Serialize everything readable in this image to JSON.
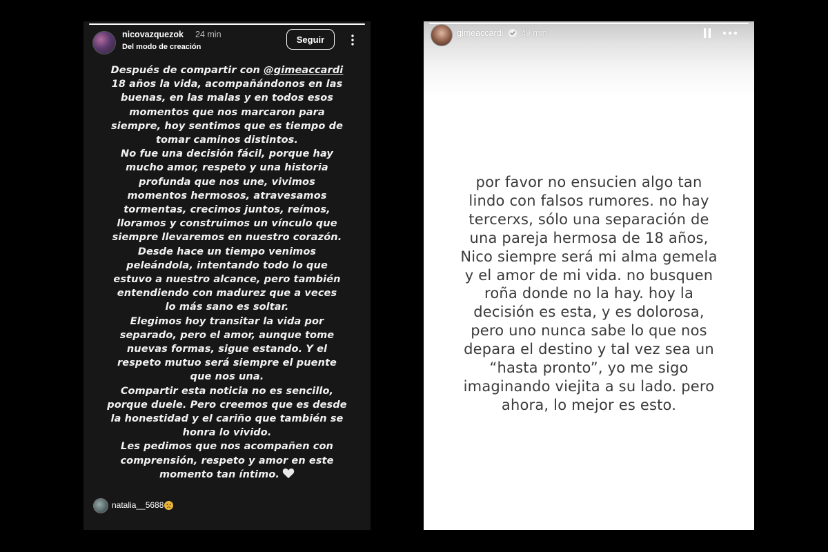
{
  "left_story": {
    "username": "nicovazquezok",
    "time": "24 min",
    "subtitle": "Del modo de creación",
    "follow_label": "Seguir",
    "text_intro": "Después de compartir con ",
    "mention": "@gimeaccardi",
    "text_body": "\n18 años la vida, acompañándonos en las\nbuenas, en las malas y en todos esos\nmomentos que nos marcaron para\nsiempre, hoy sentimos que es tiempo de\ntomar caminos distintos.\nNo fue una decisión fácil, porque hay\nmucho amor, respeto y una historia\nprofunda que nos une, vivimos\nmomentos hermosos, atravesamos\ntormentas, crecimos juntos, reímos,\nlloramos y construimos un vínculo que\nsiempre llevaremos en nuestro corazón.\nDesde hace un tiempo venimos\npeleándola, intentando todo lo que\nestuvo a nuestro alcance, pero también\nentendiendo con madurez que a veces\nlo más sano es soltar.\nElegimos hoy transitar la vida por\nseparado, pero el amor, aunque tome\nnuevas formas, sigue estando. Y el\nrespeto mutuo será siempre el puente\nque nos una.\nCompartir esta noticia no es sencillo,\nporque duele. Pero creemos que es desde\nla honestidad y el cariño que también se\nhonra lo vivido.\nLes pedimos que nos acompañen con\ncomprensión, respeto y amor en este\nmomento tan  íntimo.",
    "heart_icon": "white-heart-icon",
    "viewer_name": "natalia__5688",
    "viewer_emoji_icon": "sad-face-emoji-icon",
    "progress": 1.0
  },
  "right_story": {
    "username": "gimeaccardi",
    "time": "49 min",
    "verified_icon": "verified-badge-icon",
    "pause_icon": "pause-icon",
    "more_icon": "more-horizontal-icon",
    "text": "por favor no ensucien algo tan\nlindo con falsos rumores. no hay\ntercerxs, sólo una separación de\nuna pareja hermosa de 18 años,\nNico siempre será mi alma gemela\ny el amor de mi vida. no busquen\nroña donde no la hay. hoy la\ndecisión es esta, y es dolorosa,\npero uno nunca sabe lo que nos\ndepara el destino y tal vez sea un\n“hasta pronto”, yo me sigo\nimaginando viejita a su lado. pero\nahora, lo mejor es esto.",
    "progress": 1.0
  },
  "colors": {
    "page_background": "#000000",
    "left_story_background": "#171717",
    "right_story_background": "#ffffff",
    "right_text_color": "#3a3a3a"
  }
}
